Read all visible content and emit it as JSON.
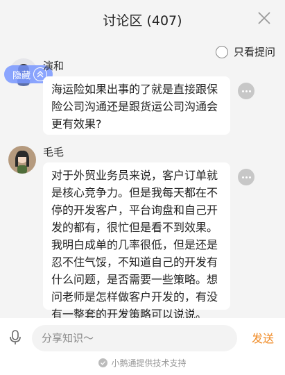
{
  "header": {
    "title": "讨论区 (407)"
  },
  "filter": {
    "label": "只看提问"
  },
  "float_button": {
    "label": "隐藏"
  },
  "posts": [
    {
      "author": "演和",
      "content": "海运险如果出事的了就是直接跟保险公司沟通还是跟货运公司沟通会更有效果?"
    },
    {
      "author": "毛毛",
      "content": "对于外贸业务员来说，客户订单就是核心竞争力。但是我每天都在不停的开发客户，平台询盘和自己开发的都有，很忙但是看不到效果。我明白成单的几率很低，但是还是忍不住气馁，不知道自己的开发有什么问题，是否需要一些策略。想问老师是怎样做客户开发的，有没有一整套的开发策略可以说说。"
    }
  ],
  "composer": {
    "placeholder": "分享知识～",
    "send_label": "发送"
  },
  "footer": {
    "text": "小鹅通提供技术支持"
  },
  "colors": {
    "accent": "#f08a24",
    "float": "#7896ff"
  }
}
